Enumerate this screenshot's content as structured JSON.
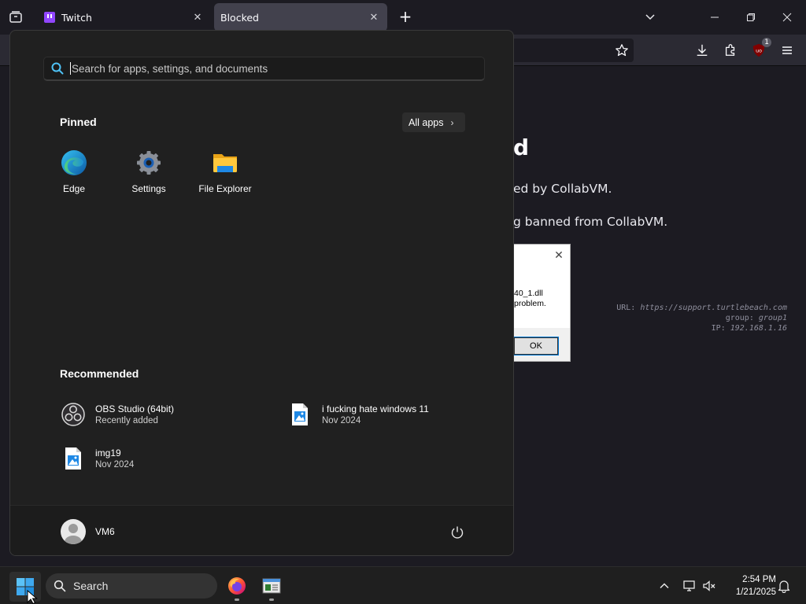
{
  "browser": {
    "tabs": [
      {
        "label": "Twitch",
        "active": false
      },
      {
        "label": "Blocked",
        "active": true
      }
    ],
    "extension_badge": "1"
  },
  "page": {
    "title_fragment": "d",
    "line1_fragment": "ed by CollabVM.",
    "line2_fragment": "g banned from CollabVM.",
    "debug": {
      "url_label": "URL:",
      "url_value": "https://support.turtlebeach.com",
      "group_label": "group:",
      "group_value": "group1",
      "ip_label": "IP:",
      "ip_value": "192.168.1.16"
    }
  },
  "dialog": {
    "line1": "40_1.dll",
    "line2": "problem.",
    "ok_label": "OK"
  },
  "start_menu": {
    "search_placeholder": "Search for apps, settings, and documents",
    "pinned_title": "Pinned",
    "all_apps_label": "All apps",
    "pinned": [
      {
        "label": "Edge",
        "icon": "edge-icon"
      },
      {
        "label": "Settings",
        "icon": "settings-gear-icon"
      },
      {
        "label": "File Explorer",
        "icon": "folder-icon"
      }
    ],
    "recommended_title": "Recommended",
    "recommended": [
      {
        "name": "OBS Studio (64bit)",
        "sub": "Recently added",
        "icon": "obs-icon"
      },
      {
        "name": "i fucking hate windows 11",
        "sub": "Nov 2024",
        "icon": "image-file-icon"
      },
      {
        "name": "img19",
        "sub": "Nov 2024",
        "icon": "image-file-icon"
      }
    ],
    "user_name": "VM6"
  },
  "taskbar": {
    "search_label": "Search",
    "time": "2:54 PM",
    "date": "1/21/2025"
  },
  "colors": {
    "accent": "#0078d4",
    "twitch": "#9146ff",
    "start_bg": "#202020",
    "taskbar_bg": "#1f1f1f"
  }
}
